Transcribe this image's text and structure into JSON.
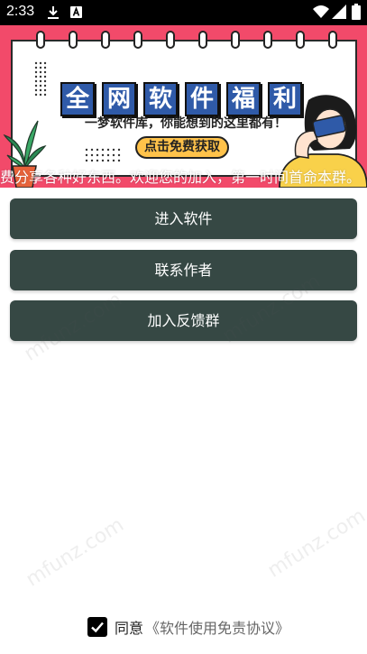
{
  "status_bar": {
    "time": "2:33",
    "icons": [
      "download-icon",
      "autofill-a-icon",
      "wifi-icon",
      "signal-icon",
      "battery-icon"
    ]
  },
  "banner": {
    "title_chars": [
      "全",
      "网",
      "软",
      "件",
      "福",
      "利"
    ],
    "subtitle": "一梦软件库，你能想到的这里都有！",
    "cta_label": "点击免费获取",
    "accent_color": "#f24a6a",
    "title_box_color": "#2f5aa8",
    "cta_color": "#ffc24a"
  },
  "marquee_text": "费分享各种好东西。欢迎您的加入，第一时间首命本群。",
  "buttons": {
    "enter_software": "进入软件",
    "contact_author": "联系作者",
    "join_feedback_group": "加入反馈群",
    "button_color": "#364844"
  },
  "agreement": {
    "prefix": "同意",
    "link": "《软件使用免责协议》",
    "checked": true
  },
  "watermark_text": "mfunz.com"
}
